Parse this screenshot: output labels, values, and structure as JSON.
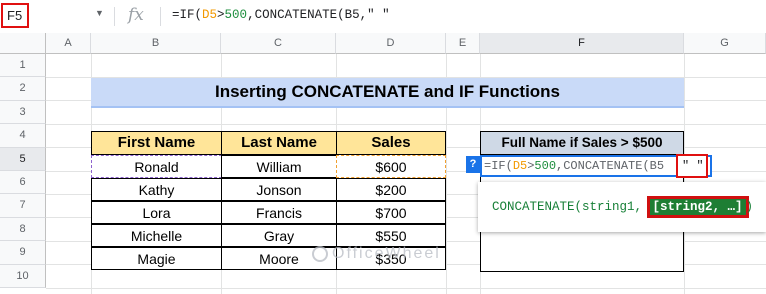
{
  "formula_bar": {
    "name_box": "F5",
    "fx_label": "fx",
    "formula_prefix": "=IF(",
    "formula_ref": "D5",
    "formula_op": ">",
    "formula_num": "500",
    "formula_suffix": ",CONCATENATE(B5,\" \""
  },
  "columns": [
    "A",
    "B",
    "C",
    "D",
    "E",
    "F",
    "G"
  ],
  "active_column": "F",
  "rows": [
    "1",
    "2",
    "3",
    "4",
    "5",
    "6",
    "7",
    "8",
    "9",
    "10"
  ],
  "active_row": "5",
  "title": "Inserting CONCATENATE and IF Functions",
  "table": {
    "headers": [
      "First Name",
      "Last Name",
      "Sales"
    ],
    "rows": [
      [
        "Ronald",
        "William",
        "$600"
      ],
      [
        "Kathy",
        "Jonson",
        "$200"
      ],
      [
        "Lora",
        "Francis",
        "$700"
      ],
      [
        "Michelle",
        "Gray",
        "$550"
      ],
      [
        "Magie",
        "Moore",
        "$350"
      ]
    ]
  },
  "result_header": "Full Name if Sales > $500",
  "editing_cell": {
    "help_icon": "?",
    "prefix": "=IF(",
    "ref": "D5",
    "op": ">",
    "num": "500",
    "mid": ",CONCATENATE(B5",
    "highlighted": "\" \""
  },
  "tooltip": {
    "prefix": "CONCATENATE(string1, ",
    "highlight": "[string2, …]",
    "suffix": ")"
  },
  "watermark": "OfficeWheel",
  "colors": {
    "title_fill": "#c9daf8",
    "header_fill": "#ffe599",
    "result_header_fill": "#cfd9e6",
    "highlight_border": "#e01010",
    "tooltip_highlight": "#1e7e34"
  }
}
